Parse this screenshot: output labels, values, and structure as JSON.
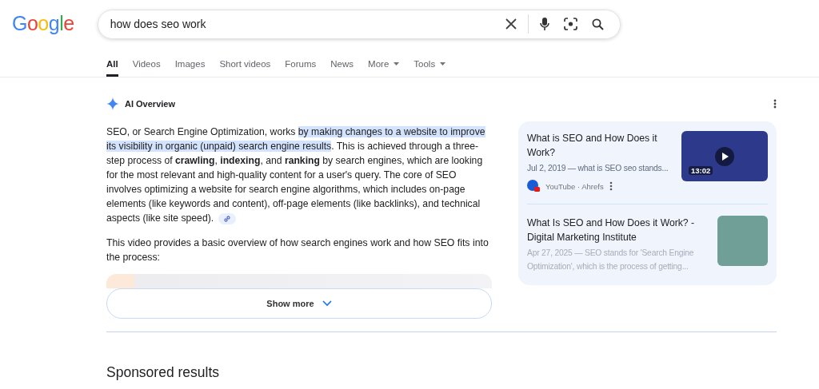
{
  "logo": "Google",
  "search": {
    "value": "how does seo work"
  },
  "tabs": [
    {
      "label": "All",
      "selected": true,
      "dropdown": false
    },
    {
      "label": "Videos",
      "selected": false,
      "dropdown": false
    },
    {
      "label": "Images",
      "selected": false,
      "dropdown": false
    },
    {
      "label": "Short videos",
      "selected": false,
      "dropdown": false
    },
    {
      "label": "Forums",
      "selected": false,
      "dropdown": false
    },
    {
      "label": "News",
      "selected": false,
      "dropdown": false
    },
    {
      "label": "More",
      "selected": false,
      "dropdown": true
    },
    {
      "label": "Tools",
      "selected": false,
      "dropdown": true
    }
  ],
  "ai_overview": {
    "title": "AI Overview",
    "paragraph": [
      {
        "text": "SEO, or Search Engine Optimization, works ",
        "highlighted": false
      },
      {
        "text": "by making changes to a website to improve its visibility in organic (unpaid) search engine results",
        "highlighted": true
      },
      {
        "text": ". This is achieved through a three-step process of **crawling**, **indexing**, and **ranking** by search engines, which are looking for the most relevant and high-quality content for a user's query. The core of SEO involves optimizing a website for search engine algorithms, which includes on-page elements (like keywords and content), off-page elements (like backlinks), and technical aspects (like site speed).",
        "highlighted": false
      }
    ],
    "video_intro": "This video provides a basic overview of how search engines work and how SEO fits into the process:",
    "show_more": "Show more",
    "sources": [
      {
        "kind": "video",
        "title": "What is SEO and How Does it Work?",
        "snippet": "Jul 2, 2019 — what is SEO seo stands...",
        "source": "YouTube · Ahrefs",
        "duration": "13:02"
      },
      {
        "kind": "article",
        "title": "What Is SEO and How Does it Work? - Digital Marketing Institute",
        "snippet": "Apr 27, 2025 — SEO stands for 'Search Engine Optimization', which is the process of getting..."
      }
    ]
  },
  "sponsored": {
    "title": "Sponsored results"
  }
}
